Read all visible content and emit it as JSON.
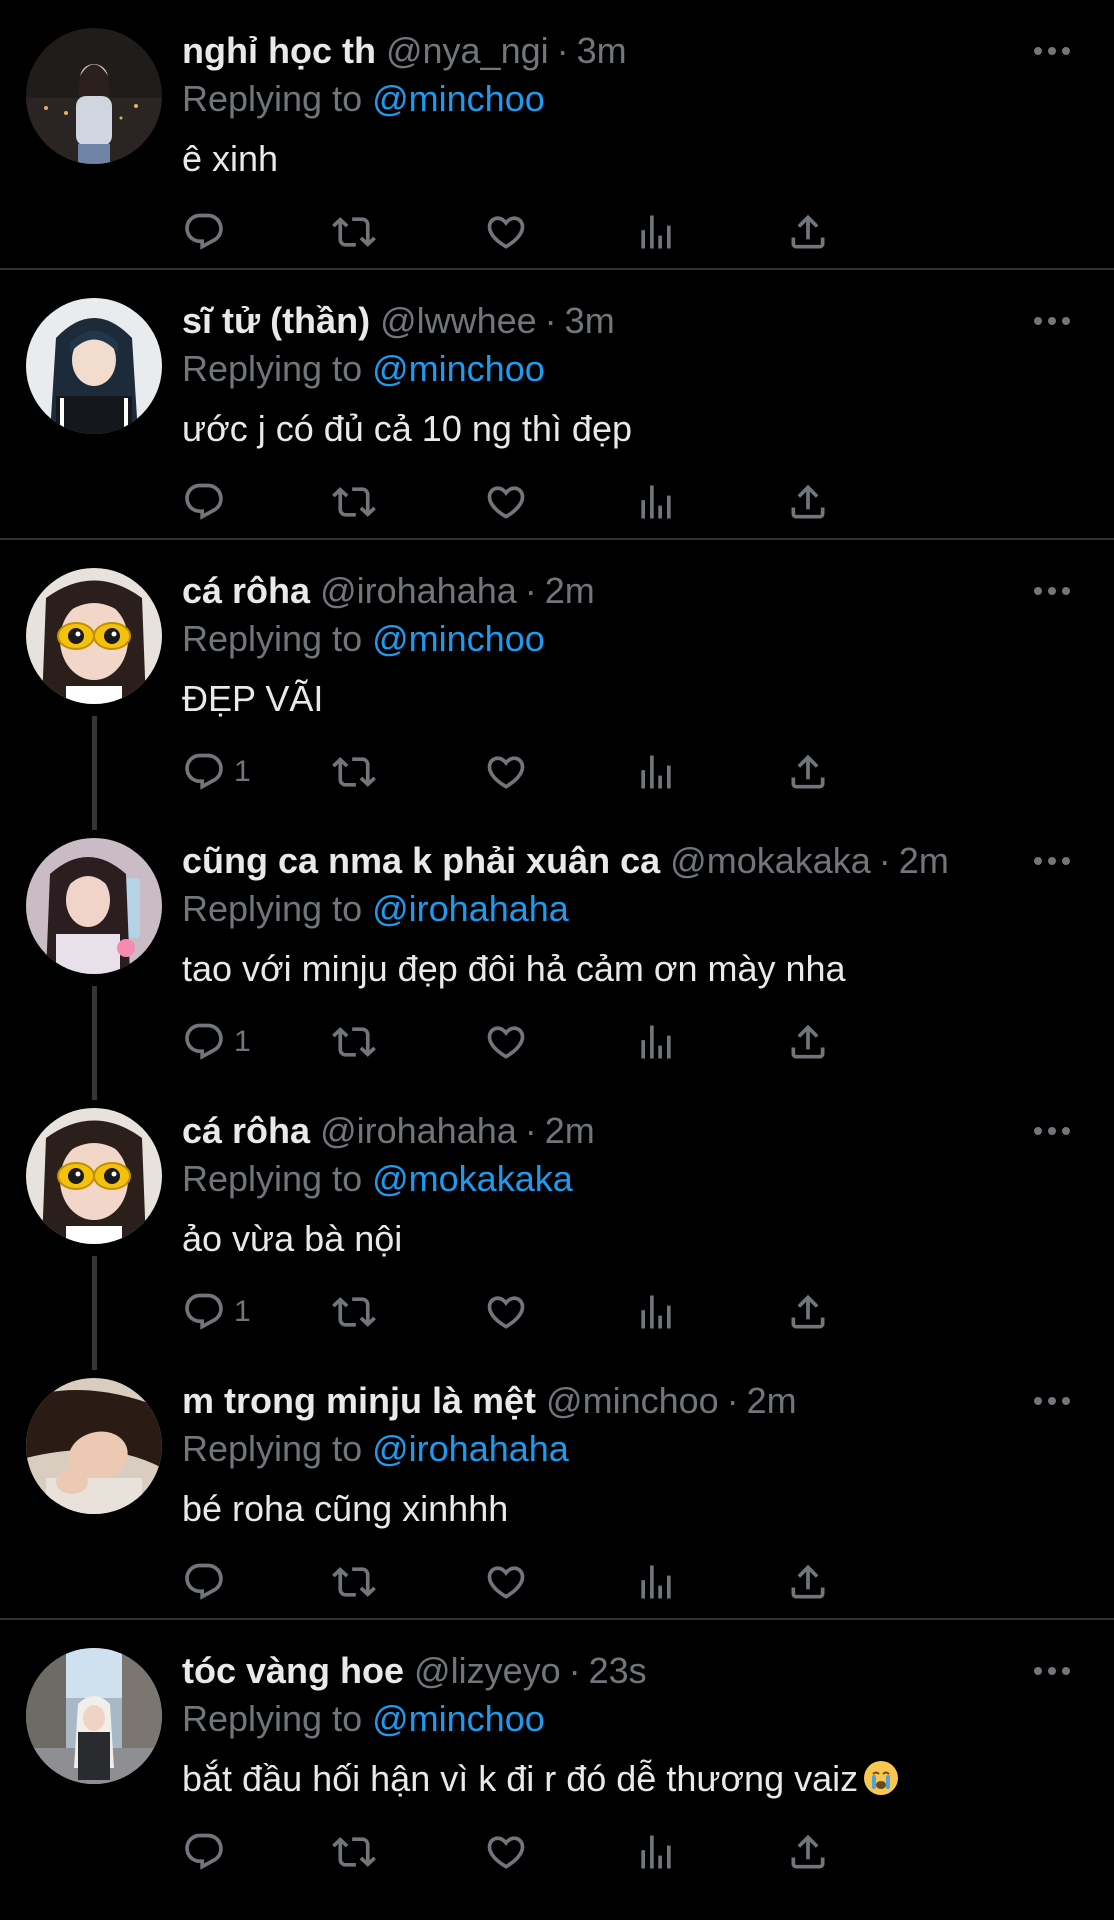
{
  "colors": {
    "background": "#000000",
    "text": "#e7e9ea",
    "muted": "#71767b",
    "accent": "#1d9bf0",
    "divider": "#2f3336"
  },
  "icons": {
    "reply": "reply-icon",
    "retweet": "retweet-icon",
    "like": "like-icon",
    "views": "views-icon",
    "share": "share-icon",
    "more": "more-icon"
  },
  "replying_prefix": "Replying to",
  "tweets": [
    {
      "name": "nghỉ học th",
      "handle": "@nya_ngi",
      "time": "3m",
      "reply_to": "@minchoo",
      "text": "ê xinh",
      "reply_count": ""
    },
    {
      "name": "sĩ tử (thần)",
      "handle": "@lwwhee",
      "time": "3m",
      "reply_to": "@minchoo",
      "text": "ước j có đủ cả 10 ng thì đẹp",
      "reply_count": ""
    },
    {
      "name": "cá rôha",
      "handle": "@irohahaha",
      "time": "2m",
      "reply_to": "@minchoo",
      "text": "ĐẸP VÃI",
      "reply_count": "1"
    },
    {
      "name": "cũng ca nma k phải xuân ca",
      "handle": "@mokakaka",
      "time": "2m",
      "reply_to": "@irohahaha",
      "text": "tao với minju đẹp đôi hả cảm ơn mày nha",
      "reply_count": "1"
    },
    {
      "name": "cá rôha",
      "handle": "@irohahaha",
      "time": "2m",
      "reply_to": "@mokakaka",
      "text": "ảo vừa bà nội",
      "reply_count": "1"
    },
    {
      "name": "m trong minju là mệt",
      "handle": "@minchoo",
      "time": "2m",
      "reply_to": "@irohahaha",
      "text": "bé roha cũng xinhhh",
      "reply_count": ""
    },
    {
      "name": "tóc vàng hoe",
      "handle": "@lizyeyo",
      "time": "23s",
      "reply_to": "@minchoo",
      "text": "bắt đầu hối hận vì k đi r đó dễ thương vaiz",
      "reply_count": ""
    }
  ]
}
